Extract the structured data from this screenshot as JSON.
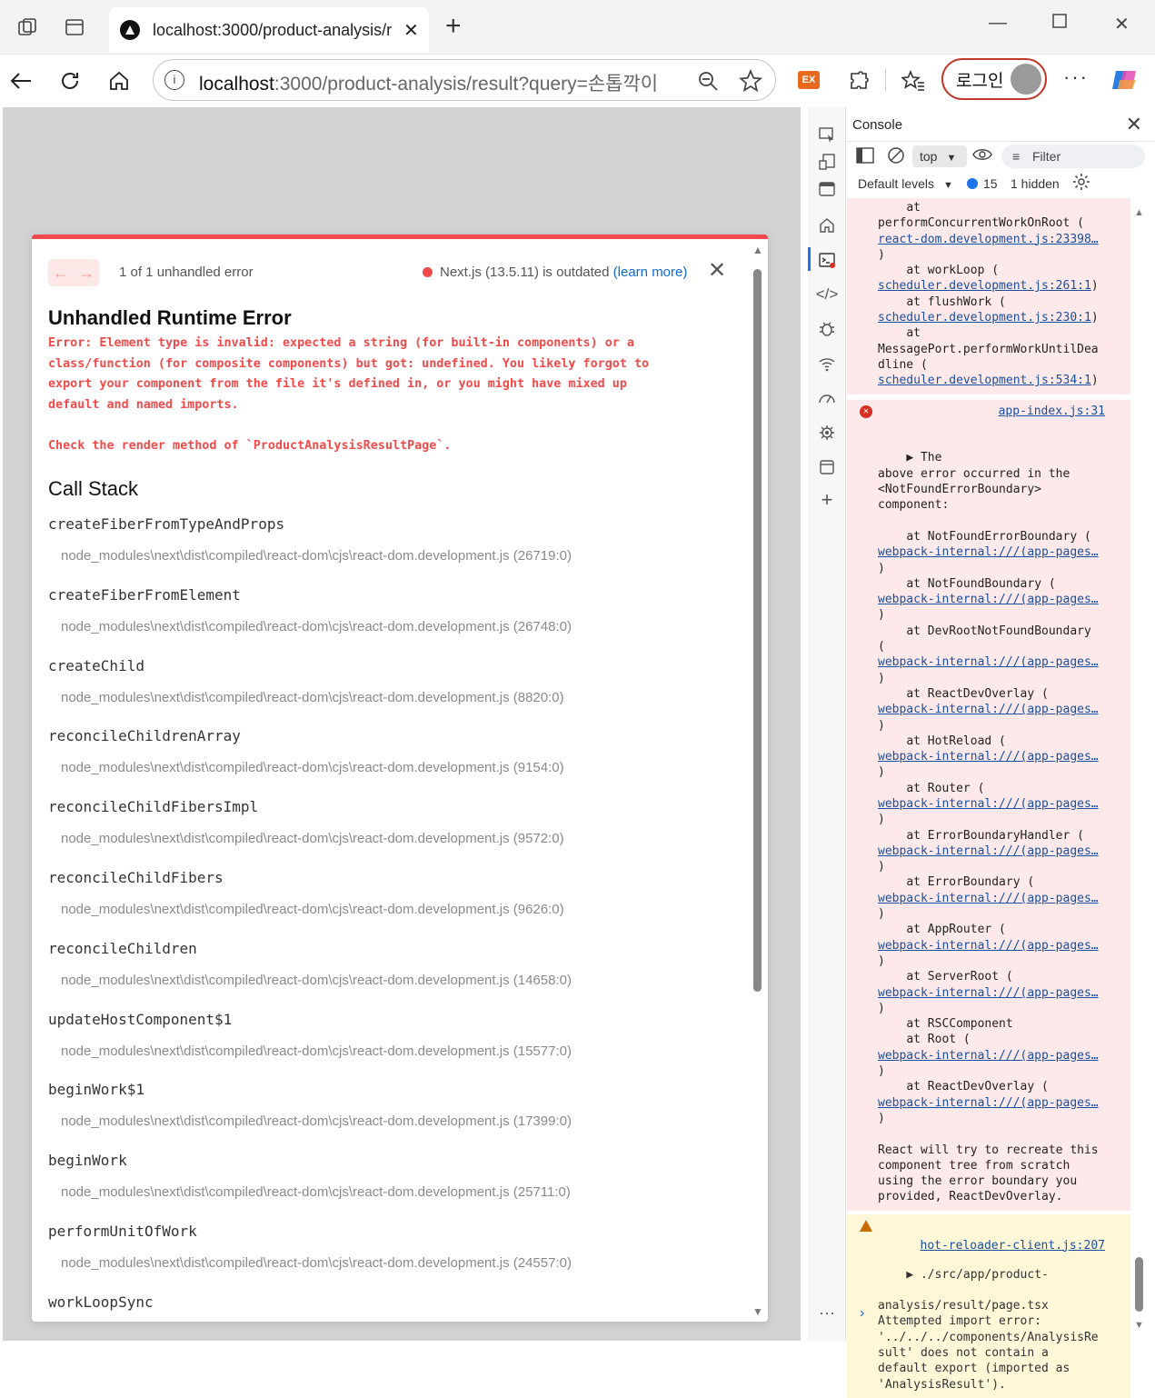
{
  "browser": {
    "tab_title": "localhost:3000/product-analysis/r",
    "new_tab_icon": "+",
    "url_host": "localhost",
    "url_rest": ":3000/product-analysis/result?query=손톱깍이",
    "login_label": "로그인",
    "extension_label": "EX"
  },
  "overlay": {
    "pager_prev": "←",
    "pager_next": "→",
    "error_count": "1 of 1 unhandled error",
    "version_text": "Next.js (13.5.11) is outdated ",
    "learn_more": "(learn more)",
    "title": "Unhandled Runtime Error",
    "message": "Error: Element type is invalid: expected a string (for built-in components) or a\nclass/function (for composite components) but got: undefined. You likely forgot to\nexport your component from the file it's defined in, or you might have mixed up\ndefault and named imports.\n\nCheck the render method of `ProductAnalysisResultPage`.",
    "call_stack_title": "Call Stack",
    "frames": [
      {
        "fn": "createFiberFromTypeAndProps",
        "loc": "node_modules\\next\\dist\\compiled\\react-dom\\cjs\\react-dom.development.js (26719:0)"
      },
      {
        "fn": "createFiberFromElement",
        "loc": "node_modules\\next\\dist\\compiled\\react-dom\\cjs\\react-dom.development.js (26748:0)"
      },
      {
        "fn": "createChild",
        "loc": "node_modules\\next\\dist\\compiled\\react-dom\\cjs\\react-dom.development.js (8820:0)"
      },
      {
        "fn": "reconcileChildrenArray",
        "loc": "node_modules\\next\\dist\\compiled\\react-dom\\cjs\\react-dom.development.js (9154:0)"
      },
      {
        "fn": "reconcileChildFibersImpl",
        "loc": "node_modules\\next\\dist\\compiled\\react-dom\\cjs\\react-dom.development.js (9572:0)"
      },
      {
        "fn": "reconcileChildFibers",
        "loc": "node_modules\\next\\dist\\compiled\\react-dom\\cjs\\react-dom.development.js (9626:0)"
      },
      {
        "fn": "reconcileChildren",
        "loc": "node_modules\\next\\dist\\compiled\\react-dom\\cjs\\react-dom.development.js (14658:0)"
      },
      {
        "fn": "updateHostComponent$1",
        "loc": "node_modules\\next\\dist\\compiled\\react-dom\\cjs\\react-dom.development.js (15577:0)"
      },
      {
        "fn": "beginWork$1",
        "loc": "node_modules\\next\\dist\\compiled\\react-dom\\cjs\\react-dom.development.js (17399:0)"
      },
      {
        "fn": "beginWork",
        "loc": "node_modules\\next\\dist\\compiled\\react-dom\\cjs\\react-dom.development.js (25711:0)"
      },
      {
        "fn": "performUnitOfWork",
        "loc": "node_modules\\next\\dist\\compiled\\react-dom\\cjs\\react-dom.development.js (24557:0)"
      },
      {
        "fn": "workLoopSync",
        "loc": ""
      }
    ]
  },
  "devtools": {
    "panel_title": "Console",
    "context": "top",
    "filter_placeholder": "Filter",
    "levels": "Default levels",
    "message_count": "15",
    "hidden": "1 hidden",
    "log1": {
      "lines": [
        {
          "t": "    at\n"
        },
        {
          "t": "performConcurrentWorkOnRoot (\n"
        },
        {
          "link": "react-dom.development.js:23398…"
        },
        {
          "t": "\n)\n"
        },
        {
          "t": "    at workLoop (\n"
        },
        {
          "link": "scheduler.development.js:261:1"
        },
        {
          "t": ")\n    at flushWork (\n"
        },
        {
          "link": "scheduler.development.js:230:1"
        },
        {
          "t": ")\n    at\nMessagePort.performWorkUntilDea\ndline (\n"
        },
        {
          "link": "scheduler.development.js:534:1"
        },
        {
          "t": ")"
        }
      ]
    },
    "log2": {
      "source": "app-index.js:31",
      "lines": [
        {
          "t": "▶ The\nabove error occurred in the\n<NotFoundErrorBoundary>\ncomponent:\n\n    at NotFoundErrorBoundary (\n"
        },
        {
          "link": "webpack-internal:///(app-pages…"
        },
        {
          "t": "\n)\n    at NotFoundBoundary (\n"
        },
        {
          "link": "webpack-internal:///(app-pages…"
        },
        {
          "t": "\n)\n    at DevRootNotFoundBoundary\n(\n"
        },
        {
          "link": "webpack-internal:///(app-pages…"
        },
        {
          "t": "\n)\n    at ReactDevOverlay (\n"
        },
        {
          "link": "webpack-internal:///(app-pages…"
        },
        {
          "t": "\n)\n    at HotReload (\n"
        },
        {
          "link": "webpack-internal:///(app-pages…"
        },
        {
          "t": "\n)\n    at Router (\n"
        },
        {
          "link": "webpack-internal:///(app-pages…"
        },
        {
          "t": "\n)\n    at ErrorBoundaryHandler (\n"
        },
        {
          "link": "webpack-internal:///(app-pages…"
        },
        {
          "t": "\n)\n    at ErrorBoundary (\n"
        },
        {
          "link": "webpack-internal:///(app-pages…"
        },
        {
          "t": "\n)\n    at AppRouter (\n"
        },
        {
          "link": "webpack-internal:///(app-pages…"
        },
        {
          "t": "\n)\n    at ServerRoot (\n"
        },
        {
          "link": "webpack-internal:///(app-pages…"
        },
        {
          "t": "\n)\n    at RSCComponent\n    at Root (\n"
        },
        {
          "link": "webpack-internal:///(app-pages…"
        },
        {
          "t": "\n)\n    at ReactDevOverlay (\n"
        },
        {
          "link": "webpack-internal:///(app-pages…"
        },
        {
          "t": "\n)\n\nReact will try to recreate this\ncomponent tree from scratch\nusing the error boundary you\nprovided, ReactDevOverlay."
        }
      ]
    },
    "log3": {
      "source": "hot-reloader-client.js:207",
      "lines": [
        {
          "t": "▶ ./src/app/product-\n\nanalysis/result/page.tsx\nAttempted import error:\n'../../../components/AnalysisRe\nsult' does not contain a\ndefault export (imported as\n'AnalysisResult')."
        }
      ]
    },
    "prompt": "›"
  }
}
